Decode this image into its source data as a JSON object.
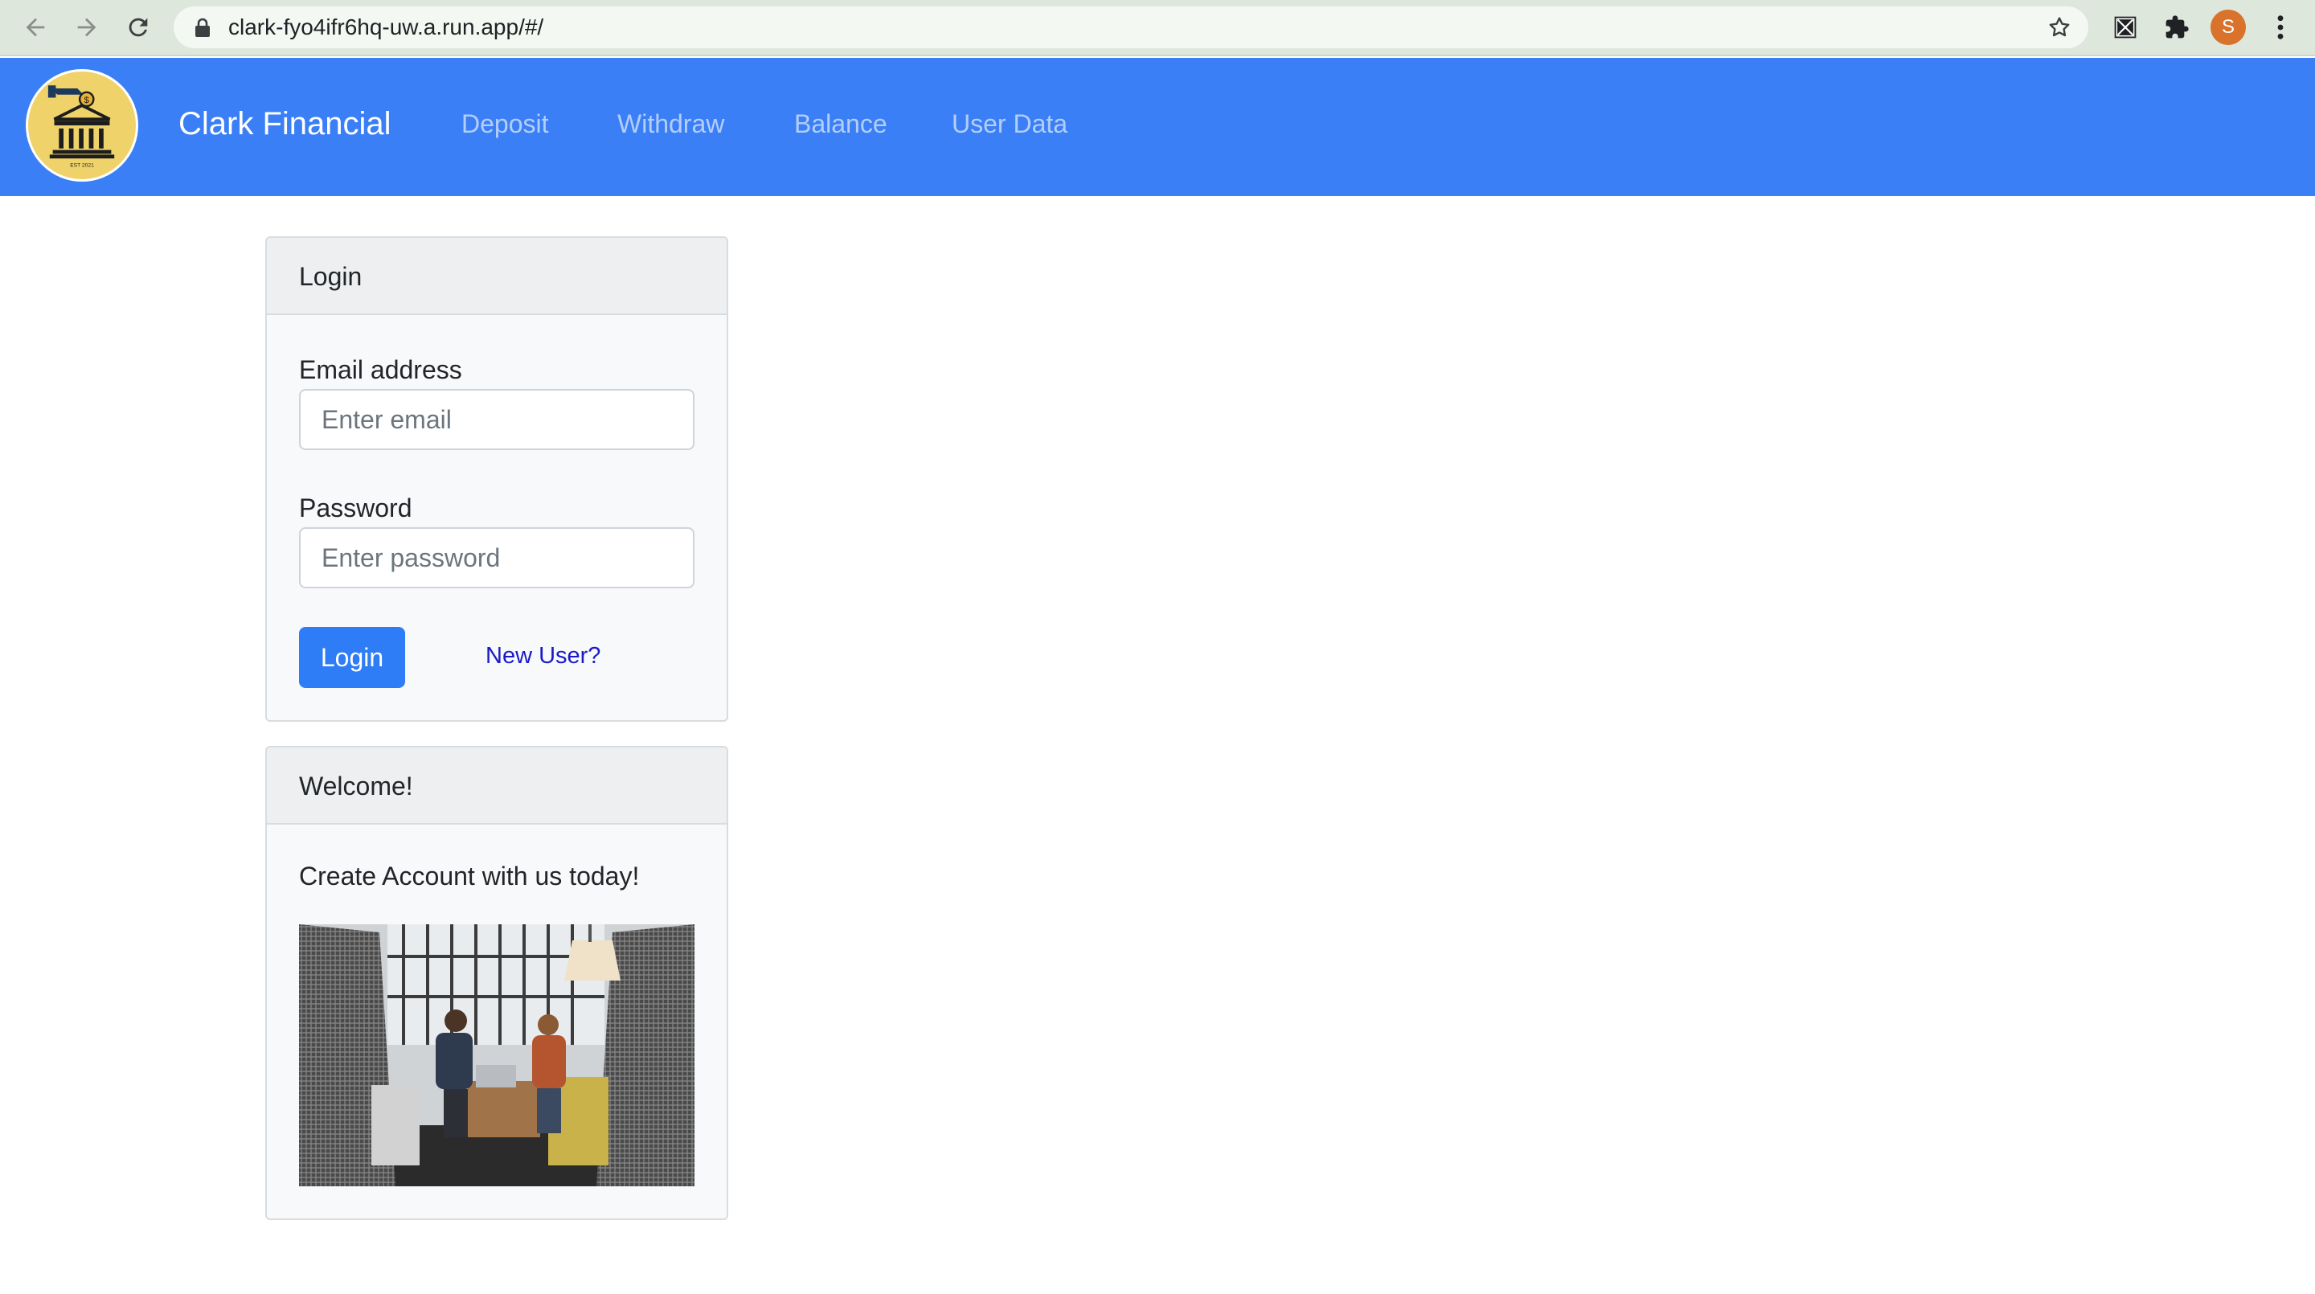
{
  "browser": {
    "url": "clark-fyo4ifr6hq-uw.a.run.app/#/",
    "profile_initial": "S",
    "icons": [
      "back-arrow-icon",
      "forward-arrow-icon",
      "reload-icon",
      "lock-icon",
      "star-icon",
      "extension-icon",
      "puzzle-icon",
      "kebab-menu-icon"
    ]
  },
  "navbar": {
    "brand": "Clark Financial",
    "links": [
      "Deposit",
      "Withdraw",
      "Balance",
      "User Data"
    ],
    "logo_caption": "EST 2021",
    "colors": {
      "background": "#3a7ff5",
      "link": "rgba(255,255,255,0.62)"
    }
  },
  "login_card": {
    "header": "Login",
    "email_label": "Email address",
    "email_placeholder": "Enter email",
    "email_value": "",
    "password_label": "Password",
    "password_placeholder": "Enter password",
    "password_value": "",
    "login_button": "Login",
    "new_user_link": "New User?"
  },
  "welcome_card": {
    "header": "Welcome!",
    "text": "Create Account with us today!"
  },
  "colors": {
    "primary": "#2f7df6",
    "link": "#1a1acb",
    "card_bg": "#f8f9fa"
  }
}
